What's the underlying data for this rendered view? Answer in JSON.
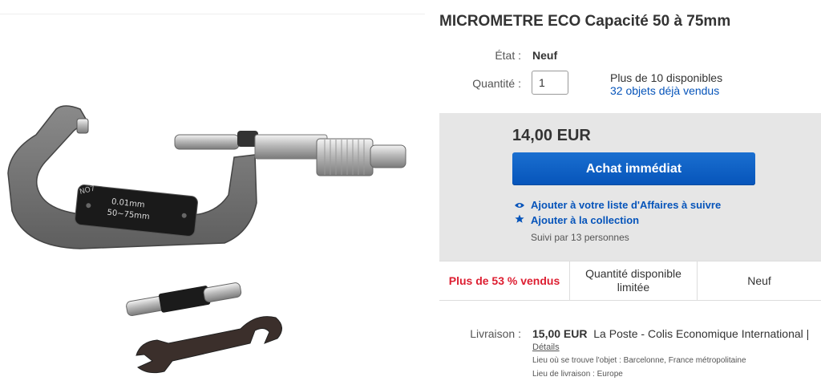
{
  "product": {
    "title": "MICROMETRE ECO Capacité 50 à 75mm",
    "image_engraving": {
      "brand": "NO7",
      "resolution": "0.01mm",
      "range": "50~75mm"
    }
  },
  "condition": {
    "label": "État :",
    "value": "Neuf"
  },
  "quantity": {
    "label": "Quantité :",
    "value": "1",
    "available": "Plus de 10 disponibles",
    "sold": "32 objets déjà vendus"
  },
  "purchase": {
    "price": "14,00 EUR",
    "buy_now": "Achat immédiat",
    "watch_link": "Ajouter à votre liste d'Affaires à suivre",
    "collection_link": "Ajouter à la collection",
    "followers": "Suivi par 13 personnes"
  },
  "highlights": [
    {
      "text": "Plus de 53 % vendus",
      "color": "#dd1e31"
    },
    {
      "text": "Quantité disponible limitée"
    },
    {
      "text": "Neuf"
    }
  ],
  "shipping": {
    "label": "Livraison :",
    "cost": "15,00 EUR",
    "service": "La Poste - Colis Economique International |",
    "details_link": "Détails",
    "item_location": "Lieu où se trouve l'objet :  Barcelonne, France métropolitaine",
    "ships_to": "Lieu de livraison :  Europe"
  },
  "icons": {
    "watch": "eye-icon",
    "collection": "star-icon"
  },
  "colors": {
    "link": "#0654ba",
    "button": "#0654ba",
    "sold_highlight": "#dd1e31",
    "buybox_bg": "#e6e6e6"
  }
}
